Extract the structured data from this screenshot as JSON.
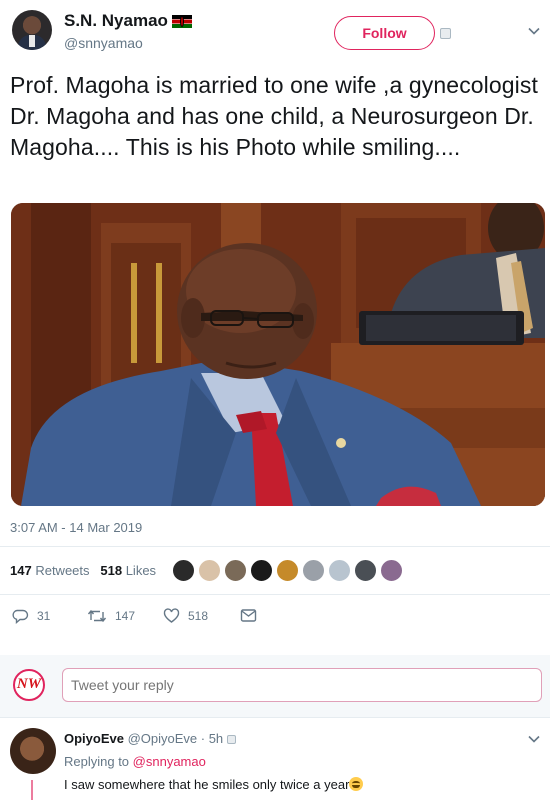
{
  "author": {
    "display_name": "S.N. Nyamao",
    "handle": "@snnyamao",
    "follow_label": "Follow"
  },
  "tweet": {
    "text": "Prof. Magoha is married to one wife ,a gynecologist Dr. Magoha and has one child, a Neurosurgeon  Dr. Magoha.... This is his Photo while smiling....",
    "timestamp": "3:07 AM - 14 Mar 2019"
  },
  "stats": {
    "retweets_count": "147",
    "retweets_label": "Retweets",
    "likes_count": "518",
    "likes_label": "Likes"
  },
  "actions": {
    "reply_count": "31",
    "retweet_count": "147",
    "like_count": "518"
  },
  "reply_box": {
    "logo_text": "NW",
    "placeholder": "Tweet your reply"
  },
  "reply": {
    "name": "OpiyoEve",
    "handle_time": "@OpiyoEve · 5h",
    "replying_prefix": "Replying to",
    "replying_handle": "@snnyamao",
    "text": "I saw somewhere that he smiles only twice a year"
  },
  "colors": {
    "accent": "#e0245e",
    "muted": "#657786",
    "text": "#14171a",
    "divider": "#e6ecf0"
  },
  "icons": [
    "chevron-down-icon",
    "reply-icon",
    "retweet-icon",
    "like-icon",
    "direct-message-icon",
    "kenya-flag-icon"
  ]
}
